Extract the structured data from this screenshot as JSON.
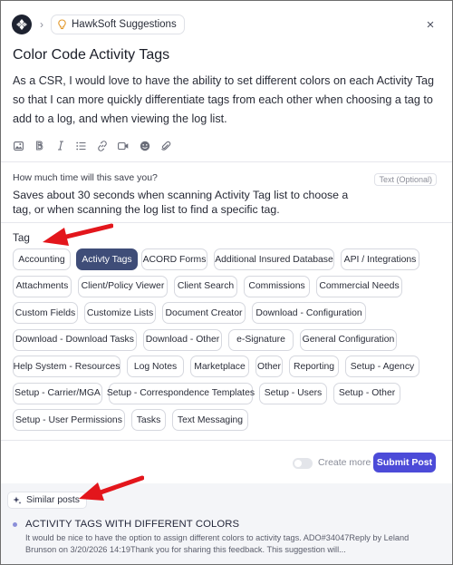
{
  "header": {
    "crumb_label": "HawkSoft Suggestions",
    "close_glyph": "×"
  },
  "post": {
    "title": "Color Code Activity Tags",
    "description": "As a CSR, I would love to have the ability to set different colors on each Activity Tag so that I can more quickly differentiate tags from each other when choosing a tag to add to a log, and when viewing the log list."
  },
  "toolbar": {
    "icons": [
      "image-icon",
      "bold-icon",
      "italic-icon",
      "list-icon",
      "link-icon",
      "video-icon",
      "emoji-icon",
      "attachment-icon"
    ]
  },
  "question": {
    "label": "How much time will this save you?",
    "badge": "Text (Optional)",
    "value": "Saves about 30 seconds when scanning Activity Tag list to choose a tag, or when scanning the log list to find a specific tag."
  },
  "tags": {
    "label": "Tag",
    "items": [
      "Accounting",
      "Activty Tags",
      "ACORD Forms",
      "Additional Insured Database",
      "API / Integrations",
      "Attachments",
      "Client/Policy Viewer",
      "Client Search",
      "Commissions",
      "Commercial Needs",
      "Custom Fields",
      "Customize Lists",
      "Document Creator",
      "Download - Configuration",
      "Download - Download Tasks",
      "Download - Other",
      "e-Signature",
      "General Configuration",
      "Help System - Resources",
      "Log Notes",
      "Marketplace",
      "Other",
      "Reporting",
      "Setup - Agency",
      "Setup - Carrier/MGA",
      "Setup - Correspondence Templates",
      "Setup - Users",
      "Setup - Other",
      "Setup - User Permissions",
      "Tasks",
      "Text Messaging"
    ],
    "selected": "Activty Tags"
  },
  "footer": {
    "create_more_label": "Create more",
    "create_more_on": false,
    "submit_label": "Submit Post"
  },
  "similar": {
    "label": "Similar posts",
    "posts": [
      {
        "title": "ACTIVITY TAGS WITH DIFFERENT COLORS",
        "snippet": "It would be nice to have the option to assign different colors to activity tags. ADO#34047Reply by Leland Brunson on 3/20/2026 14:19Thank you for sharing this feedback. This suggestion will..."
      }
    ]
  },
  "colors": {
    "accent": "#4c4bd8",
    "selected_tag": "#3f4d78",
    "annotation_arrow": "#e3161c"
  }
}
